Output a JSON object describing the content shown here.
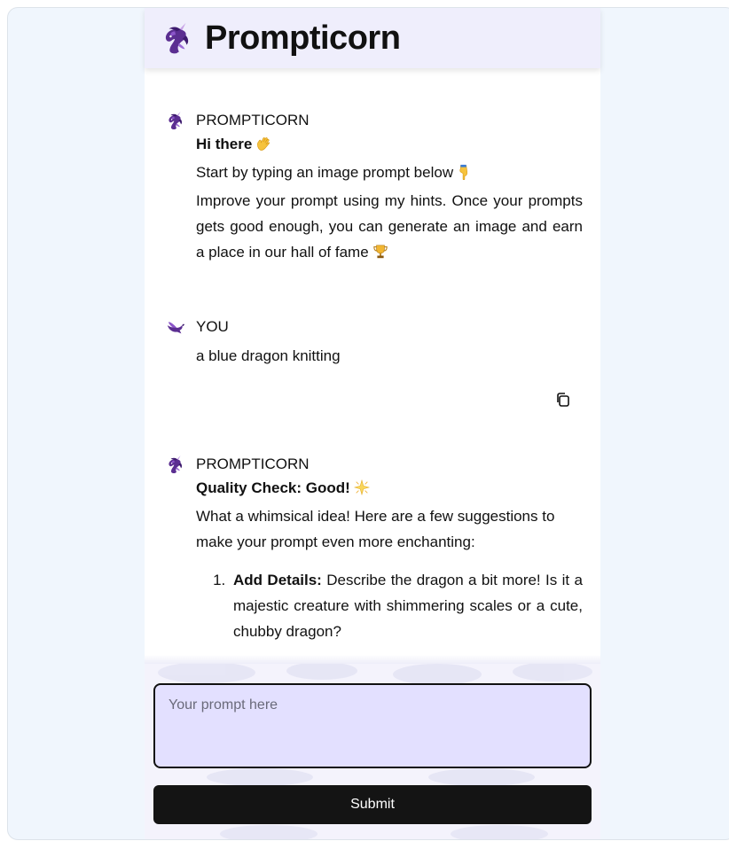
{
  "header": {
    "title": "Prompticorn",
    "logo_icon": "unicorn-icon"
  },
  "messages": [
    {
      "sender": "PROMPTICORN",
      "avatar_icon": "unicorn-icon",
      "greeting": "Hi there",
      "greeting_emoji": "waving-hand-icon",
      "line1": "Start by typing an image prompt below",
      "line1_emoji": "pointing-down-icon",
      "line2": "Improve your prompt using my hints. Once your prompts gets good enough, you can generate an image and earn a place in our hall of fame",
      "line2_emoji": "trophy-icon"
    },
    {
      "sender": "YOU",
      "avatar_icon": "dove-icon",
      "text": "a blue dragon knitting",
      "copy_icon": "copy-icon"
    },
    {
      "sender": "PROMPTICORN",
      "avatar_icon": "unicorn-icon",
      "heading": "Quality Check: Good!",
      "heading_emoji": "sparkle-star-icon",
      "intro": "What a whimsical idea! Here are a few suggestions to make your prompt even more enchanting:",
      "suggestions": [
        {
          "title": "Add Details:",
          "text": "Describe the dragon a bit more! Is it a majestic creature with shimmering scales or a cute, chubby dragon?"
        }
      ]
    }
  ],
  "input": {
    "placeholder": "Your prompt here",
    "value": ""
  },
  "submit": {
    "label": "Submit"
  },
  "colors": {
    "header_bg": "#efeefc",
    "input_bg": "#e3e0ff",
    "button_bg": "#141414",
    "page_bg": "#f0f6fd"
  }
}
